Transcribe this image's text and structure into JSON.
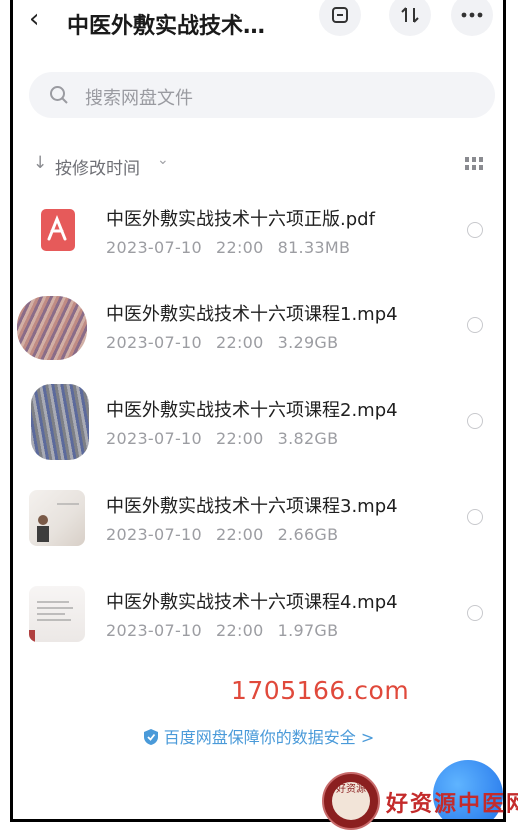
{
  "header": {
    "title": "中医外敷实战技术…",
    "icons": [
      "back-icon",
      "select-icon",
      "sort-icon",
      "more-icon"
    ]
  },
  "search": {
    "placeholder": "搜索网盘文件"
  },
  "sort": {
    "label": "按修改时间"
  },
  "files": [
    {
      "name": "中医外敷实战技术十六项正版.pdf",
      "date": "2023-07-10",
      "time": "22:00",
      "size": "81.33MB",
      "kind": "pdf"
    },
    {
      "name": "中医外敷实战技术十六项课程1.mp4",
      "date": "2023-07-10",
      "time": "22:00",
      "size": "3.29GB",
      "kind": "video"
    },
    {
      "name": "中医外敷实战技术十六项课程2.mp4",
      "date": "2023-07-10",
      "time": "22:00",
      "size": "3.82GB",
      "kind": "video"
    },
    {
      "name": "中医外敷实战技术十六项课程3.mp4",
      "date": "2023-07-10",
      "time": "22:00",
      "size": "2.66GB",
      "kind": "video"
    },
    {
      "name": "中医外敷实战技术十六项课程4.mp4",
      "date": "2023-07-10",
      "time": "22:00",
      "size": "1.97GB",
      "kind": "video"
    }
  ],
  "watermark": "1705166.com",
  "security_link": "百度网盘保障你的数据安全 >",
  "brand": {
    "seal_text": "好资源",
    "name": "好资源中医网"
  },
  "colors": {
    "accent": "#4a9ad9",
    "pdf_red": "#e65a5a",
    "watermark_red": "#e0493b"
  }
}
